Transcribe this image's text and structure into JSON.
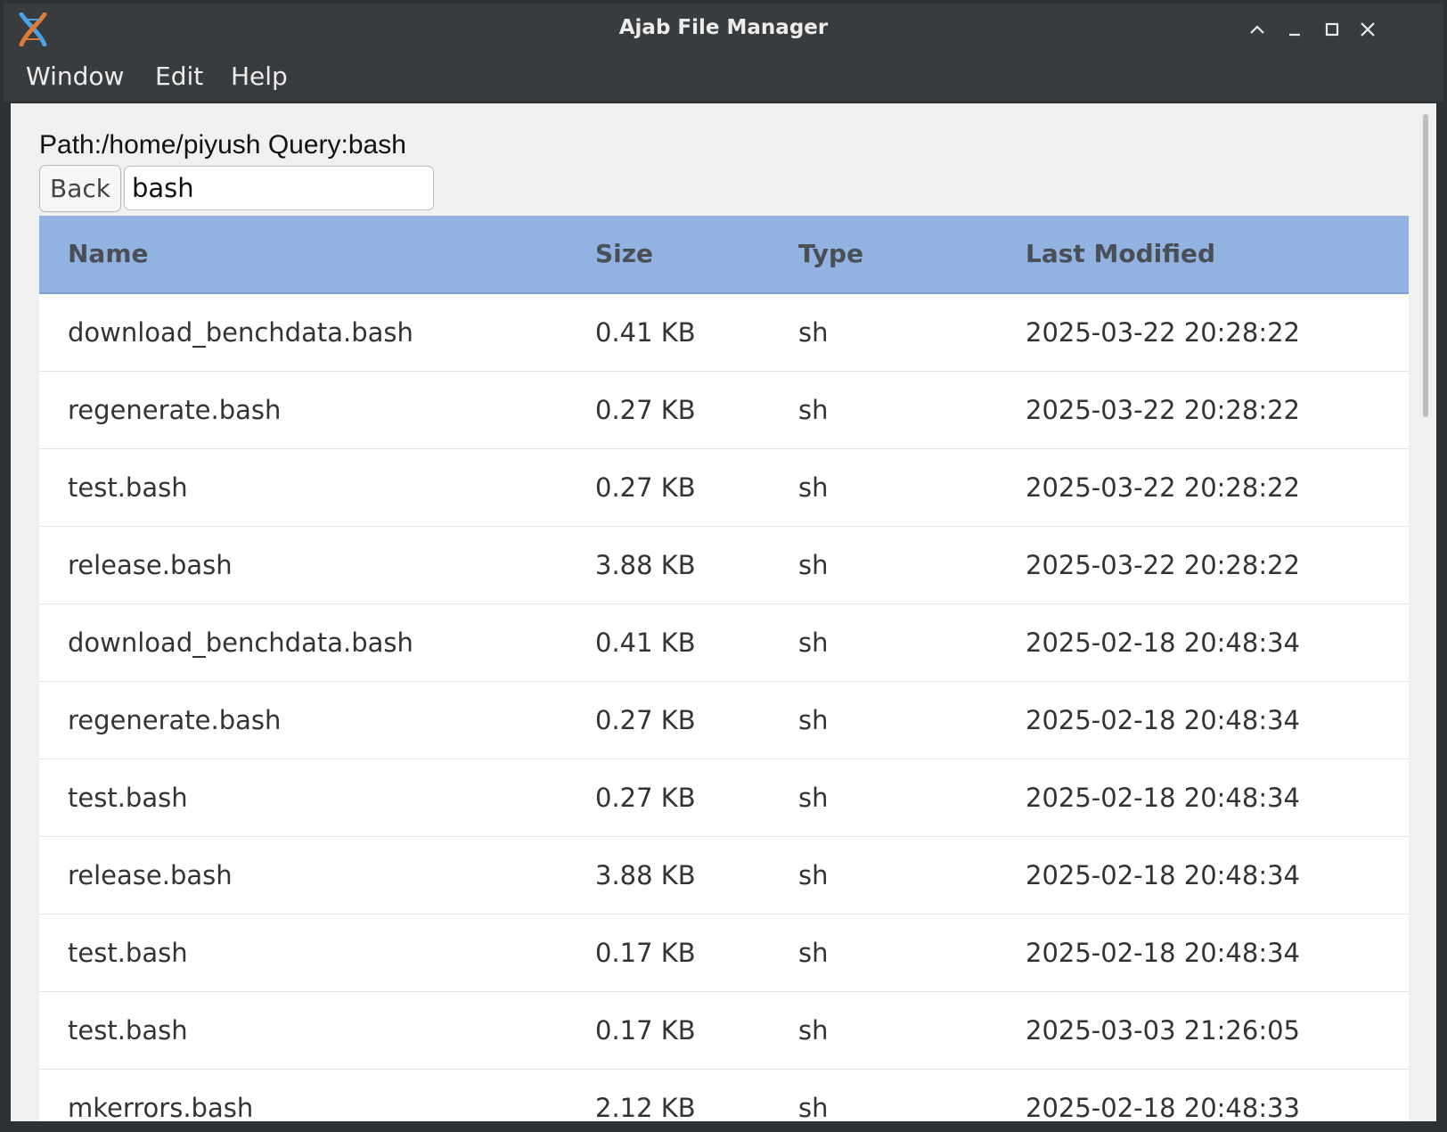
{
  "window": {
    "title": "Ajab File Manager",
    "icon": "dna-icon"
  },
  "menubar": {
    "items": [
      "Window",
      "Edit",
      "Help"
    ]
  },
  "toolbar": {
    "path_label": "Path:/home/piyush Query:bash",
    "back_label": "Back",
    "search_value": "bash"
  },
  "table": {
    "headers": {
      "name": "Name",
      "size": "Size",
      "type": "Type",
      "modified": "Last Modified"
    },
    "header_color": "#92b3e1",
    "rows": [
      {
        "name": "download_benchdata.bash",
        "size": "0.41 KB",
        "type": "sh",
        "modified": "2025-03-22 20:28:22"
      },
      {
        "name": "regenerate.bash",
        "size": "0.27 KB",
        "type": "sh",
        "modified": "2025-03-22 20:28:22"
      },
      {
        "name": "test.bash",
        "size": "0.27 KB",
        "type": "sh",
        "modified": "2025-03-22 20:28:22"
      },
      {
        "name": "release.bash",
        "size": "3.88 KB",
        "type": "sh",
        "modified": "2025-03-22 20:28:22"
      },
      {
        "name": "download_benchdata.bash",
        "size": "0.41 KB",
        "type": "sh",
        "modified": "2025-02-18 20:48:34"
      },
      {
        "name": "regenerate.bash",
        "size": "0.27 KB",
        "type": "sh",
        "modified": "2025-02-18 20:48:34"
      },
      {
        "name": "test.bash",
        "size": "0.27 KB",
        "type": "sh",
        "modified": "2025-02-18 20:48:34"
      },
      {
        "name": "release.bash",
        "size": "3.88 KB",
        "type": "sh",
        "modified": "2025-02-18 20:48:34"
      },
      {
        "name": "test.bash",
        "size": "0.17 KB",
        "type": "sh",
        "modified": "2025-02-18 20:48:34"
      },
      {
        "name": "test.bash",
        "size": "0.17 KB",
        "type": "sh",
        "modified": "2025-03-03 21:26:05"
      },
      {
        "name": "mkerrors.bash",
        "size": "2.12 KB",
        "type": "sh",
        "modified": "2025-02-18 20:48:33"
      }
    ]
  }
}
